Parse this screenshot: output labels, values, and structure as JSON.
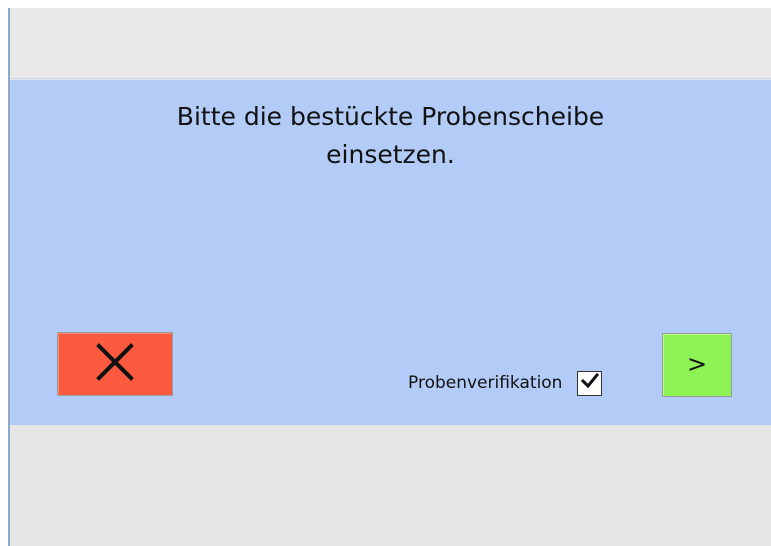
{
  "dialog": {
    "message_line1": "Bitte die bestückte Probenscheibe",
    "message_line2": "einsetzen."
  },
  "buttons": {
    "cancel_icon": "close-icon",
    "next_label": ">"
  },
  "verification": {
    "label": "Probenverifikation",
    "checked": true
  },
  "colors": {
    "panel_background": "#b3ccf7",
    "cancel_button": "#fa5a3e",
    "next_button": "#8df254",
    "window_background": "#e6e6e6"
  }
}
